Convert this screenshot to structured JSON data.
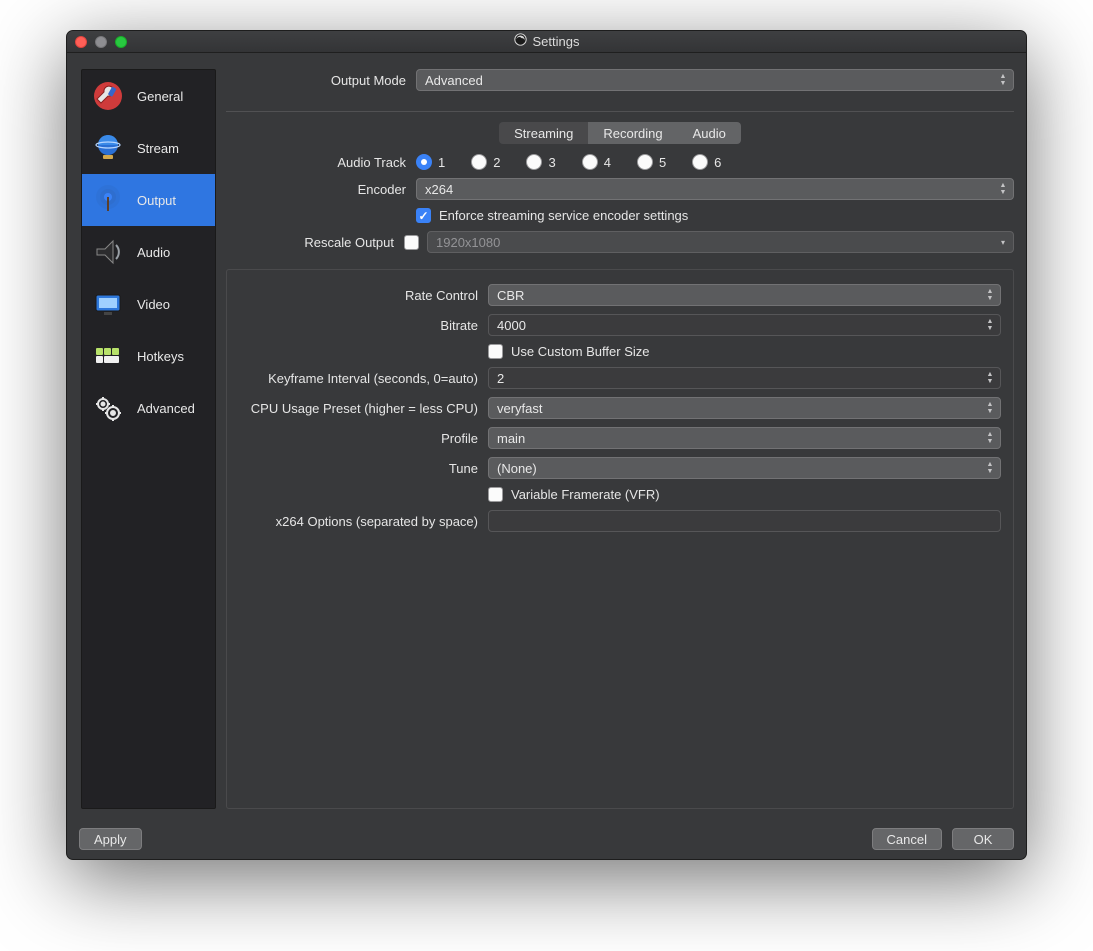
{
  "window": {
    "title": "Settings"
  },
  "sidebar": {
    "items": [
      {
        "label": "General"
      },
      {
        "label": "Stream"
      },
      {
        "label": "Output"
      },
      {
        "label": "Audio"
      },
      {
        "label": "Video"
      },
      {
        "label": "Hotkeys"
      },
      {
        "label": "Advanced"
      }
    ]
  },
  "top": {
    "output_mode_label": "Output Mode",
    "output_mode_value": "Advanced"
  },
  "tabs": {
    "streaming": "Streaming",
    "recording": "Recording",
    "audio": "Audio"
  },
  "stream": {
    "audio_track_label": "Audio Track",
    "tracks": [
      "1",
      "2",
      "3",
      "4",
      "5",
      "6"
    ],
    "encoder_label": "Encoder",
    "encoder_value": "x264",
    "enforce_label": "Enforce streaming service encoder settings",
    "rescale_label": "Rescale Output",
    "rescale_value": "1920x1080"
  },
  "encoder": {
    "rate_control_label": "Rate Control",
    "rate_control_value": "CBR",
    "bitrate_label": "Bitrate",
    "bitrate_value": "4000",
    "custom_buffer_label": "Use Custom Buffer Size",
    "keyframe_label": "Keyframe Interval (seconds, 0=auto)",
    "keyframe_value": "2",
    "cpu_preset_label": "CPU Usage Preset (higher = less CPU)",
    "cpu_preset_value": "veryfast",
    "profile_label": "Profile",
    "profile_value": "main",
    "tune_label": "Tune",
    "tune_value": "(None)",
    "vfr_label": "Variable Framerate (VFR)",
    "x264_label": "x264 Options (separated by space)",
    "x264_value": ""
  },
  "footer": {
    "apply": "Apply",
    "cancel": "Cancel",
    "ok": "OK"
  }
}
